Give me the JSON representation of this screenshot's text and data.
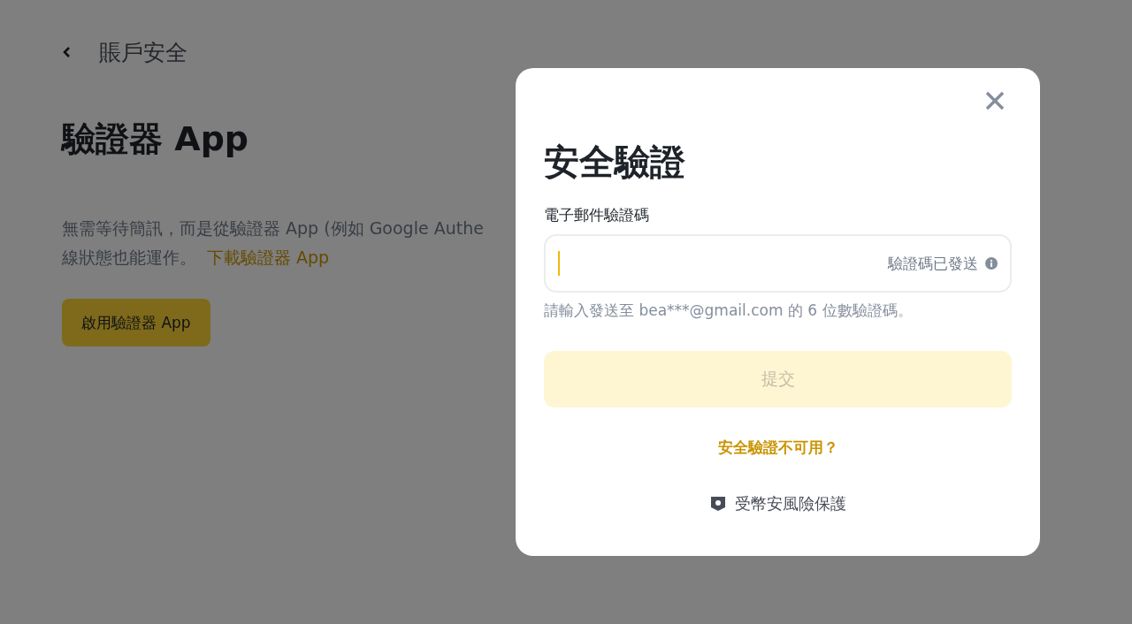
{
  "page": {
    "back_label": "賬戶安全",
    "title": "驗證器 App",
    "description_lines": [
      "無需等待簡訊，而是從驗證器 App (例如 Google Authe",
      "線狀態也能運作。"
    ],
    "download_link": "下載驗證器 App",
    "enable_button": "啟用驗證器 App"
  },
  "modal": {
    "title": "安全驗證",
    "field": {
      "label": "電子郵件驗證碼",
      "focused": true,
      "suffix": "驗證碼已發送",
      "hint": "請輸入發送至 bea***@gmail.com 的 6 位數驗證碼。"
    },
    "submit": {
      "label": "提交",
      "disabled": true
    },
    "help_link": "安全驗證不可用？",
    "footer": "受幣安風險保護"
  }
}
